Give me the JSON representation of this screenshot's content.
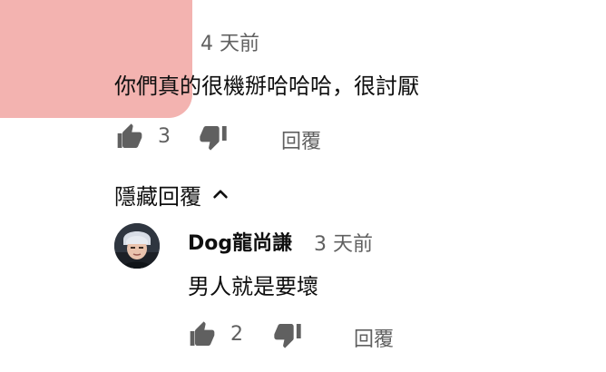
{
  "parent_comment": {
    "timestamp": "4 天前",
    "text": "你們真的很機掰哈哈哈，很討厭",
    "likes": "3",
    "reply_label": "回覆"
  },
  "replies_toggle": {
    "label": "隱藏回覆"
  },
  "reply_comment": {
    "author": "Dog龍尚謙",
    "timestamp": "3 天前",
    "text": "男人就是要壞",
    "likes": "2",
    "reply_label": "回覆"
  },
  "icons": {
    "like": "thumbs-up-icon",
    "dislike": "thumbs-down-icon",
    "toggle": "chevron-up-icon"
  },
  "colors": {
    "text_primary": "#0f0f0f",
    "text_secondary": "#606060",
    "icon": "#606060",
    "avatar_blob": "#f3b3b0"
  }
}
